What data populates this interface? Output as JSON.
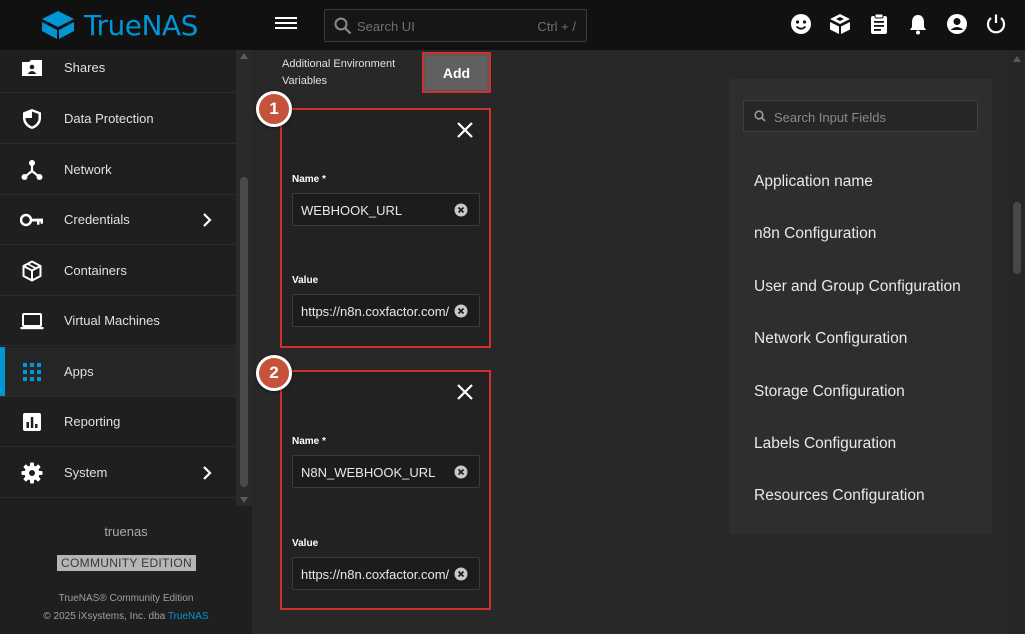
{
  "header": {
    "brand": "TrueNAS",
    "search_placeholder": "Search UI",
    "search_shortcut": "Ctrl + /",
    "icons": [
      "feedback-icon",
      "truecommand-icon",
      "jobs-icon",
      "alerts-icon",
      "account-icon",
      "power-icon"
    ]
  },
  "sidebar": {
    "items": [
      {
        "label": "Shares",
        "icon": "shares-icon"
      },
      {
        "label": "Data Protection",
        "icon": "shield-icon"
      },
      {
        "label": "Network",
        "icon": "network-icon"
      },
      {
        "label": "Credentials",
        "icon": "key-icon"
      },
      {
        "label": "Containers",
        "icon": "cube-icon"
      },
      {
        "label": "Virtual Machines",
        "icon": "laptop-icon"
      },
      {
        "label": "Apps",
        "icon": "apps-grid-icon"
      },
      {
        "label": "Reporting",
        "icon": "chart-icon"
      },
      {
        "label": "System",
        "icon": "gear-icon"
      }
    ],
    "active": "Apps",
    "hostname": "truenas",
    "edition": "COMMUNITY EDITION",
    "footer_line1": "TrueNAS® Community Edition",
    "footer_line2_prefix": "© 2025 iXsystems, Inc. dba",
    "footer_line2_link": "TrueNAS"
  },
  "main": {
    "env_label": "Additional Environment Variables",
    "add_label": "Add",
    "entries": [
      {
        "badge": "1",
        "name_label": "Name *",
        "name": "WEBHOOK_URL",
        "value_label": "Value",
        "value": "https://n8n.coxfactor.com/"
      },
      {
        "badge": "2",
        "name_label": "Name *",
        "name": "N8N_WEBHOOK_URL",
        "value_label": "Value",
        "value": "https://n8n.coxfactor.com/"
      }
    ]
  },
  "right_panel": {
    "search_placeholder": "Search Input Fields",
    "sections": [
      "Application name",
      "n8n Configuration",
      "User and Group Configuration",
      "Network Configuration",
      "Storage Configuration",
      "Labels Configuration",
      "Resources Configuration"
    ]
  },
  "colors": {
    "accent": "#0095d5",
    "highlight": "#d32f2f",
    "badge": "#c5523a"
  }
}
